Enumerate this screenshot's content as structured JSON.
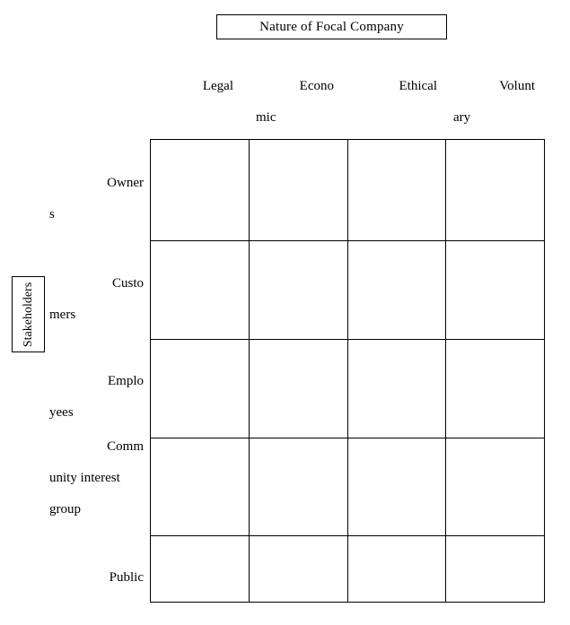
{
  "figure": {
    "title": "Nature of Focal Company",
    "axis_label_vertical": "Stakeholders"
  },
  "columns": [
    {
      "id": "legal",
      "line1": "Legal",
      "line2": ""
    },
    {
      "id": "economic",
      "line1": "Econo",
      "line2": "mic"
    },
    {
      "id": "ethical",
      "line1": "Ethical",
      "line2": ""
    },
    {
      "id": "voluntary",
      "line1": "Volunt",
      "line2": "ary"
    }
  ],
  "rows": [
    {
      "id": "owners",
      "line1": "Owner",
      "line2": "s",
      "line3": ""
    },
    {
      "id": "customers",
      "line1": "Custo",
      "line2": "mers",
      "line3": ""
    },
    {
      "id": "employees",
      "line1": "Emplo",
      "line2": "yees",
      "line3": ""
    },
    {
      "id": "community",
      "line1": "Comm",
      "line2": "unity interest",
      "line3": "group"
    },
    {
      "id": "public",
      "line1": "Public",
      "line2": "",
      "line3": ""
    }
  ],
  "cells": [
    [
      "",
      "",
      "",
      ""
    ],
    [
      "",
      "",
      "",
      ""
    ],
    [
      "",
      "",
      "",
      ""
    ],
    [
      "",
      "",
      "",
      ""
    ],
    [
      "",
      "",
      "",
      ""
    ]
  ],
  "colors": {
    "background": "#ffffff",
    "line": "#000000",
    "text": "#000000"
  }
}
